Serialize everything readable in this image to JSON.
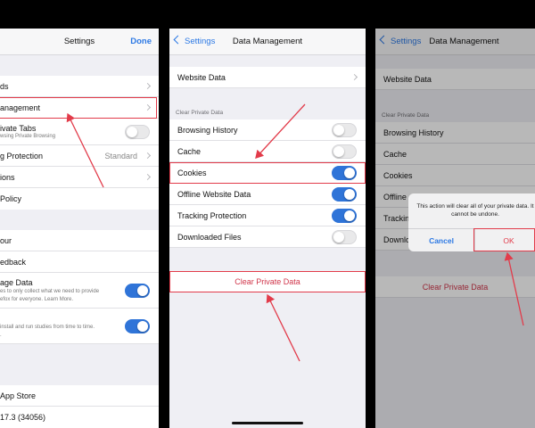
{
  "colors": {
    "accent": "#2b78e4",
    "toggle_on": "#2f74d8",
    "destructive": "#d0354a",
    "annotation": "#e23b4a"
  },
  "screen1": {
    "title": "Settings",
    "done": "Done",
    "rows": [
      {
        "label": "ds"
      },
      {
        "label": "anagement"
      },
      {
        "label": "ivate Tabs",
        "sub": "wsing Private Browsing"
      },
      {
        "label": "g Protection",
        "value": "Standard"
      },
      {
        "label": "ions"
      },
      {
        "label": "Policy"
      },
      {
        "label": "our"
      },
      {
        "label": "edback"
      },
      {
        "label": "age Data",
        "sub1": "es to only collect what we need to provide",
        "sub2": "efox for everyone. Learn More."
      },
      {
        "label": "",
        "sub1": "install and run studies from time to time.",
        "sub2": "."
      },
      {
        "label": "App Store"
      },
      {
        "label": "17.3 (34056)"
      }
    ]
  },
  "screen2": {
    "back": "Settings",
    "title": "Data Management",
    "website_data": "Website Data",
    "section_header": "Clear Private Data",
    "items": [
      {
        "label": "Browsing History",
        "on": false
      },
      {
        "label": "Cache",
        "on": false
      },
      {
        "label": "Cookies",
        "on": true
      },
      {
        "label": "Offline Website Data",
        "on": true
      },
      {
        "label": "Tracking Protection",
        "on": true
      },
      {
        "label": "Downloaded Files",
        "on": false
      }
    ],
    "clear_button": "Clear Private Data"
  },
  "screen3": {
    "back": "Settings",
    "title": "Data Management",
    "website_data": "Website Data",
    "section_header": "Clear Private Data",
    "items": [
      "Browsing History",
      "Cache",
      "Cookies",
      "Offline",
      "Trackin",
      "Downlo"
    ],
    "clear_button": "Clear Private Data",
    "alert": {
      "message": "This action will clear all of your private data. It cannot be undone.",
      "cancel": "Cancel",
      "ok": "OK"
    }
  }
}
